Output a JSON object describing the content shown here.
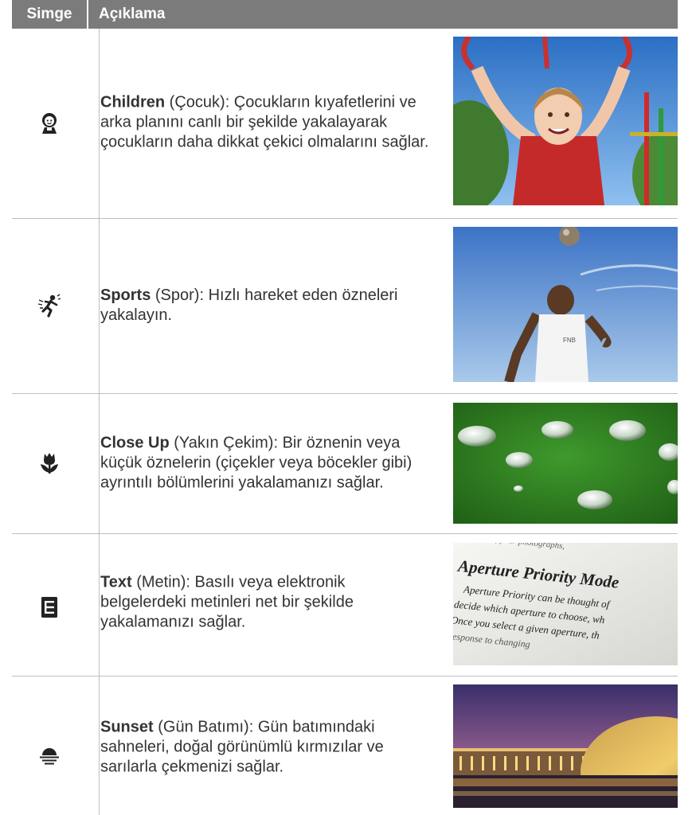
{
  "header": {
    "col_icon": "Simge",
    "col_desc": "Açıklama"
  },
  "rows": [
    {
      "mode": "Children",
      "desc": " (Çocuk): Çocukların kıyafetlerini ve arka planını canlı bir şekilde yakalayarak çocukların daha dikkat çekici olmalarını sağlar.",
      "icon": "child-icon"
    },
    {
      "mode": "Sports",
      "desc": " (Spor): Hızlı hareket eden özneleri yakalayın.",
      "icon": "runner-icon"
    },
    {
      "mode": "Close Up",
      "desc": " (Yakın Çekim): Bir öznenin veya küçük öznelerin (çiçekler veya böcekler gibi) ayrıntılı bölümlerini yakalamanızı sağlar.",
      "icon": "tulip-icon"
    },
    {
      "mode": "Text",
      "desc": " (Metin): Basılı veya elektronik belgelerdeki metinleri net bir şekilde yakalamanızı sağlar.",
      "icon": "document-icon"
    },
    {
      "mode": "Sunset",
      "desc": " (Gün Batımı): Gün batımındaki sahneleri, doğal görünümlü kırmızılar ve sarılarla çekmenizi sağlar.",
      "icon": "sunset-icon"
    }
  ],
  "text_photo": {
    "line0": "of your photographs,",
    "title": "Aperture Priority Mode",
    "line1": "Aperture Priority can be thought of",
    "line2": "decide which aperture to choose, wh",
    "line3": "Once you select a given aperture, th",
    "line4": "response to changing"
  }
}
